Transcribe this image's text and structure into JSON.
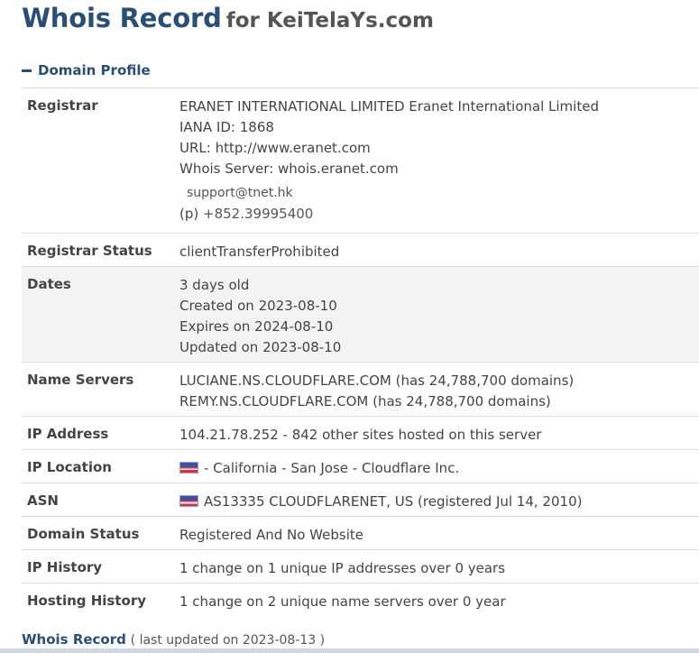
{
  "header": {
    "title": "Whois Record",
    "subtitle": "for KeiTelaYs.com"
  },
  "section": {
    "label": "Domain Profile"
  },
  "rows": {
    "registrar": {
      "label": "Registrar",
      "name": "ERANET INTERNATIONAL LIMITED Eranet International Limited",
      "iana": "IANA ID: 1868",
      "url": "URL: http://www.eranet.com",
      "whois_server": "Whois Server: whois.eranet.com",
      "email": "support@tnet.hk",
      "phone_prefix": "(p)",
      "phone": "+852.39995400"
    },
    "registrar_status": {
      "label": "Registrar Status",
      "value": "clientTransferProhibited"
    },
    "dates": {
      "label": "Dates",
      "age": "3 days old",
      "created": "Created on 2023-08-10",
      "expires": "Expires on 2024-08-10",
      "updated": "Updated on 2023-08-10"
    },
    "name_servers": {
      "label": "Name Servers",
      "ns1": "LUCIANE.NS.CLOUDFLARE.COM (has 24,788,700 domains)",
      "ns2": "REMY.NS.CLOUDFLARE.COM (has 24,788,700 domains)"
    },
    "ip_address": {
      "label": "IP Address",
      "value": "104.21.78.252 - 842 other sites hosted on this server"
    },
    "ip_location": {
      "label": "IP Location",
      "value": "- California - San Jose - Cloudflare Inc."
    },
    "asn": {
      "label": "ASN",
      "value": "AS13335 CLOUDFLARENET, US (registered Jul 14, 2010)"
    },
    "domain_status": {
      "label": "Domain Status",
      "value": "Registered And No Website"
    },
    "ip_history": {
      "label": "IP History",
      "value": "1 change on 1 unique IP addresses over 0 years"
    },
    "hosting_history": {
      "label": "Hosting History",
      "value": "1 change on 2 unique name servers over 0 year"
    }
  },
  "footer": {
    "link": "Whois Record",
    "note": "( last updated on 2023-08-13 )"
  },
  "icons": {
    "flag": "us-flag-icon",
    "collapse": "minus-icon"
  },
  "colors": {
    "accent": "#2b4e74",
    "row_alt_bg": "#f3f3f3"
  }
}
